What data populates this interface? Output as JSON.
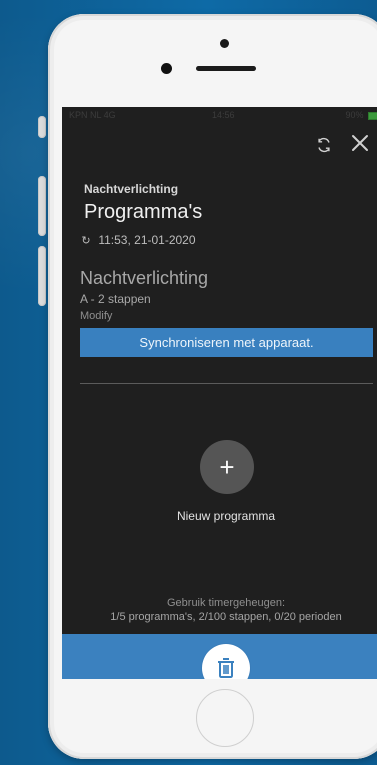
{
  "device": {
    "status_bar": {
      "carrier": "KPN NL 4G",
      "time": "14:56",
      "battery": "90%"
    }
  },
  "header": {
    "sync_icon": "sync-icon",
    "close_icon": "close-icon",
    "breadcrumb": "Nachtverlichting",
    "title": "Programma's",
    "sync_time": "11:53, 21-01-2020"
  },
  "program_card": {
    "name": "Nachtverlichting",
    "steps": "A - 2 stappen",
    "modify_label": "Modify",
    "sync_button_label": "Synchroniseren met apparaat."
  },
  "add_program": {
    "icon": "plus-icon",
    "label": "Nieuw programma"
  },
  "usage": {
    "title": "Gebruik timergeheugen:",
    "values": "1/5 programma's, 2/100 stappen, 0/20 perioden"
  },
  "footer": {
    "delete_icon": "trash-icon"
  },
  "colors": {
    "background": "#0d5e95",
    "screen": "#1f1f1f",
    "accent": "#3980bf",
    "button_circle": "#555555"
  }
}
